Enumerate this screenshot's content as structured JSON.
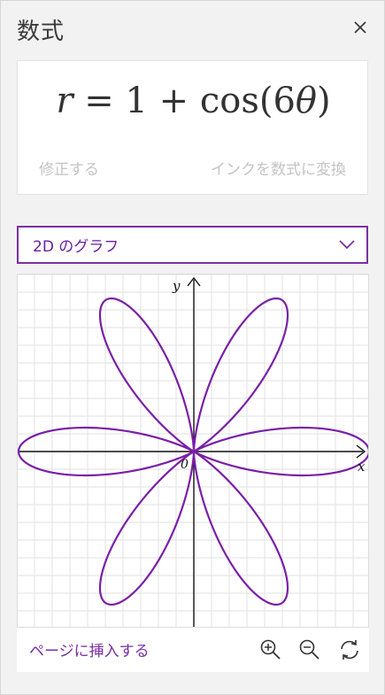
{
  "header": {
    "title": "数式",
    "close_label": "×"
  },
  "equation": {
    "lhs": "r",
    "equals": " = ",
    "rhs_prefix": "1 + cos(6",
    "theta": "θ",
    "rhs_suffix": ")"
  },
  "card_actions": {
    "fix_label": "修正する",
    "convert_label": "インクを数式に変換"
  },
  "graph_type": {
    "selected": "2D のグラフ"
  },
  "graph": {
    "x_label": "x",
    "y_label": "y",
    "origin_label": "0",
    "curve_color": "#7a1fa8",
    "axis_color": "#111111",
    "grid_color": "#e2e2e2"
  },
  "footer": {
    "insert_label": "ページに挿入する"
  },
  "icons": {
    "close": "close-icon",
    "chevron": "chevron-down-icon",
    "zoom_in": "zoom-in-icon",
    "zoom_out": "zoom-out-icon",
    "reset": "reset-view-icon"
  },
  "colors": {
    "accent": "#7a2fa6",
    "disabled_text": "#c4c4c4",
    "panel_bg": "#f2f2f2"
  }
}
